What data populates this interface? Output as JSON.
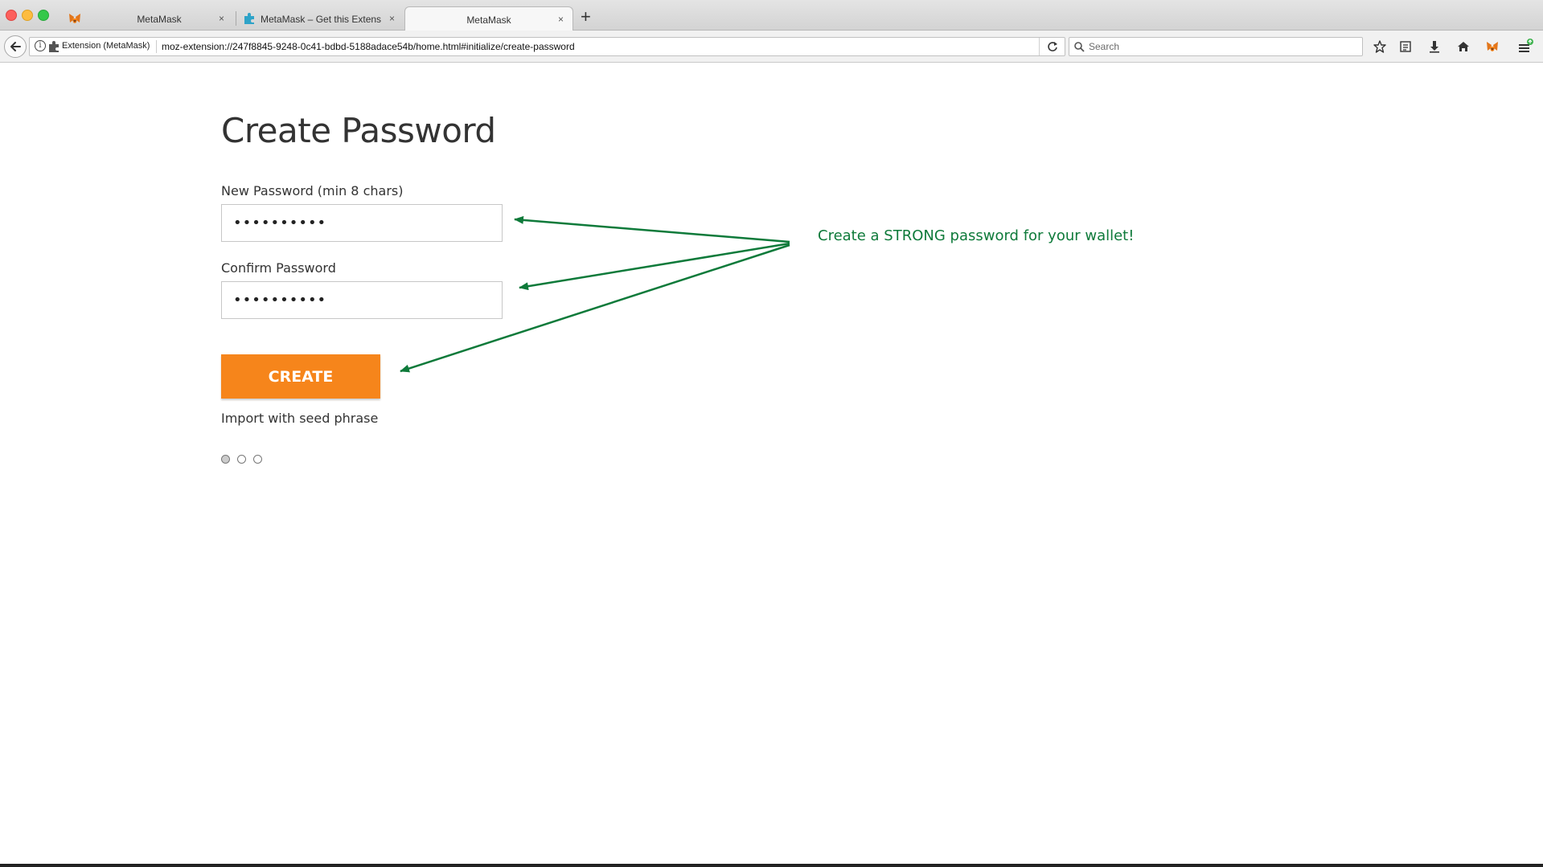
{
  "browser": {
    "tabs": [
      {
        "title": ""
      },
      {
        "title": "MetaMask"
      },
      {
        "title": "MetaMask – Get this Extension for Firefox"
      },
      {
        "title": "MetaMask"
      }
    ],
    "tab_close_glyph": "×",
    "new_tab_glyph": "+",
    "identity_label": "Extension (MetaMask)",
    "url": "moz-extension://247f8845-9248-0c41-bdbd-5188adace54b/home.html#initialize/create-password",
    "search_placeholder": "Search",
    "icons": [
      "back-arrow-icon",
      "info-icon",
      "extension-icon",
      "reload-icon",
      "search-icon",
      "bookmark-star-icon",
      "reading-list-icon",
      "download-icon",
      "home-icon",
      "metamask-fox-icon",
      "menu-icon"
    ]
  },
  "page": {
    "title": "Create Password",
    "new_password_label": "New Password (min 8 chars)",
    "new_password_value": "••••••••••",
    "confirm_password_label": "Confirm Password",
    "confirm_password_value": "••••••••••",
    "create_button": "CREATE",
    "import_link": "Import with seed phrase",
    "step_dots": {
      "total": 3,
      "current": 1
    }
  },
  "annotation": {
    "text": "Create a STRONG password for your wallet!",
    "color": "#0e7a3a"
  },
  "colors": {
    "accent": "#f6851b",
    "annotation": "#0e7a3a"
  }
}
